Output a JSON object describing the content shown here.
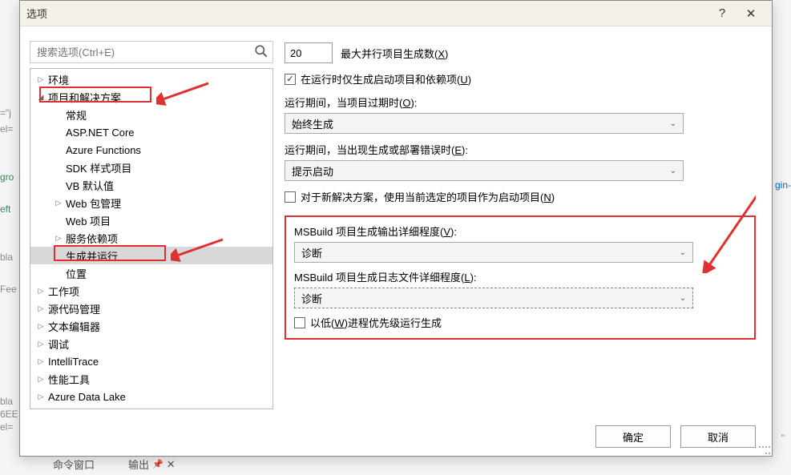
{
  "dialog": {
    "title": "选项",
    "search_placeholder": "搜索选项(Ctrl+E)",
    "ok_label": "确定",
    "cancel_label": "取消"
  },
  "tree": [
    {
      "label": "环境",
      "depth": 0,
      "expander": "▷"
    },
    {
      "label": "项目和解决方案",
      "depth": 0,
      "expander": "◢",
      "highlighted": true
    },
    {
      "label": "常规",
      "depth": 1,
      "expander": ""
    },
    {
      "label": "ASP.NET Core",
      "depth": 1,
      "expander": ""
    },
    {
      "label": "Azure Functions",
      "depth": 1,
      "expander": ""
    },
    {
      "label": "SDK 样式项目",
      "depth": 1,
      "expander": ""
    },
    {
      "label": "VB 默认值",
      "depth": 1,
      "expander": ""
    },
    {
      "label": "Web 包管理",
      "depth": 1,
      "expander": "▷"
    },
    {
      "label": "Web 项目",
      "depth": 1,
      "expander": ""
    },
    {
      "label": "服务依赖项",
      "depth": 1,
      "expander": "▷"
    },
    {
      "label": "生成并运行",
      "depth": 1,
      "expander": "",
      "selected": true,
      "highlighted": true
    },
    {
      "label": "位置",
      "depth": 1,
      "expander": ""
    },
    {
      "label": "工作项",
      "depth": 0,
      "expander": "▷"
    },
    {
      "label": "源代码管理",
      "depth": 0,
      "expander": "▷"
    },
    {
      "label": "文本编辑器",
      "depth": 0,
      "expander": "▷"
    },
    {
      "label": "调试",
      "depth": 0,
      "expander": "▷"
    },
    {
      "label": "IntelliTrace",
      "depth": 0,
      "expander": "▷"
    },
    {
      "label": "性能工具",
      "depth": 0,
      "expander": "▷"
    },
    {
      "label": "Azure Data Lake",
      "depth": 0,
      "expander": "▷"
    }
  ],
  "settings": {
    "max_parallel_value": "20",
    "max_parallel_label": "最大并行项目生成数(X)",
    "only_startup_checked": true,
    "only_startup_label": "在运行时仅生成启动项目和依赖项(U)",
    "on_run_outdated_label": "运行期间，当项目过期时(O):",
    "on_run_outdated_value": "始终生成",
    "on_run_error_label": "运行期间，当出现生成或部署错误时(E):",
    "on_run_error_value": "提示启动",
    "use_selected_as_startup_checked": false,
    "use_selected_as_startup_label": "对于新解决方案，使用当前选定的项目作为启动项目(N)",
    "msbuild_output_label": "MSBuild 项目生成输出详细程度(V):",
    "msbuild_output_value": "诊断",
    "msbuild_log_label": "MSBuild 项目生成日志文件详细程度(L):",
    "msbuild_log_value": "诊断",
    "low_priority_checked": false,
    "low_priority_label": "以低(W)进程优先级运行生成"
  },
  "bg": {
    "t1": "=\"j",
    "t2": "el=",
    "t3": "gro",
    "t4": "eft",
    "t5": "bla",
    "t6": "Fee",
    "t7": "bla",
    "t8": "6EE",
    "t9": "el=",
    "t10": "gin-",
    "t11": "\"",
    "tab1": "命令窗口",
    "tab2": "输出"
  }
}
